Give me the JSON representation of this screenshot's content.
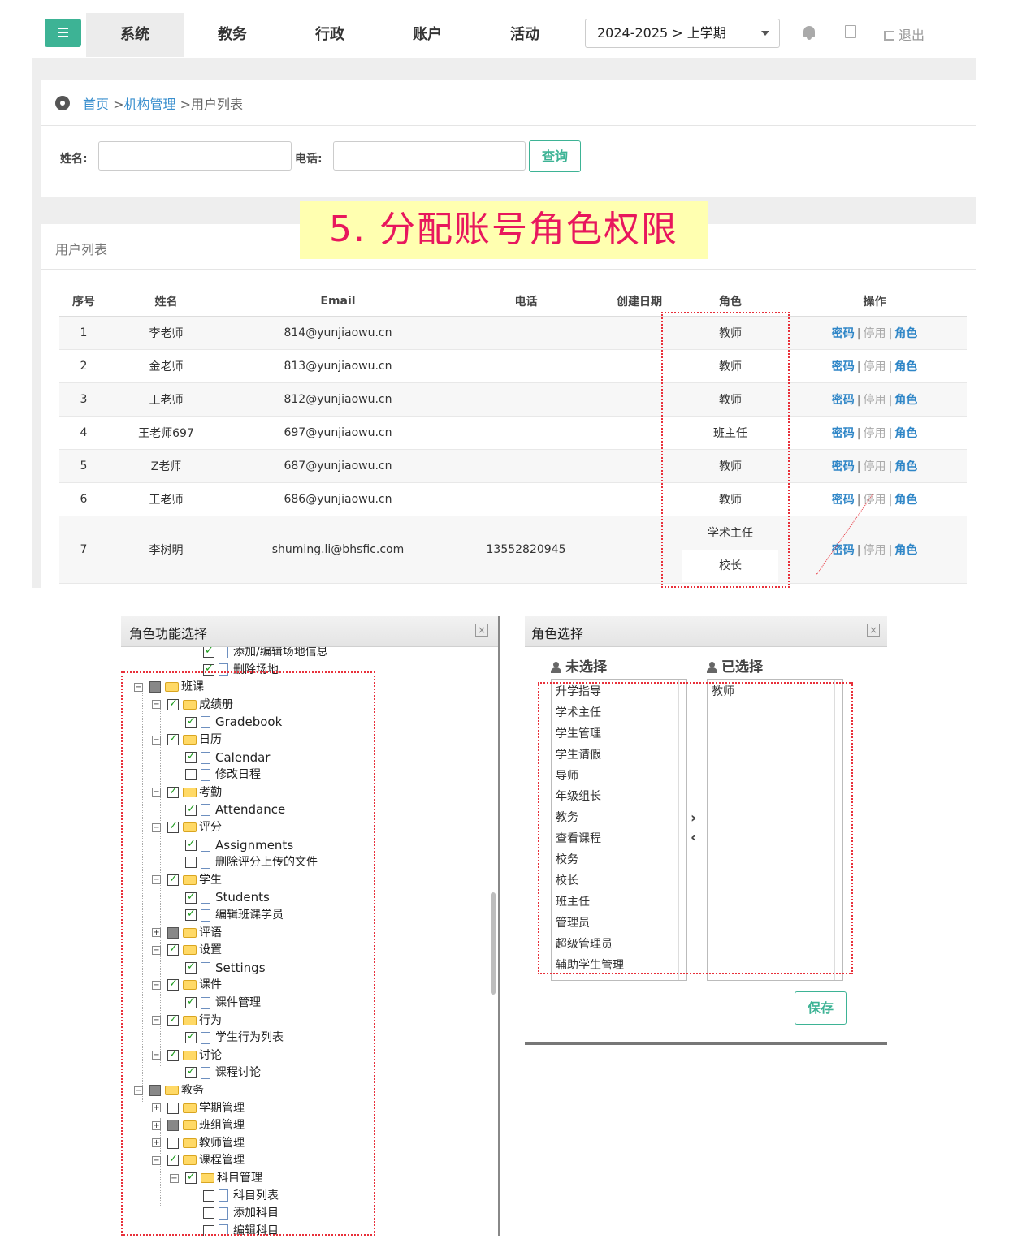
{
  "nav": {
    "items": [
      "系统",
      "教务",
      "行政",
      "账户",
      "活动"
    ],
    "term": "2024-2025 > 上学期",
    "logout": "退出"
  },
  "breadcrumb": {
    "home": "首页",
    "sep1": ">",
    "org": "机构管理",
    "sep2": ">",
    "current": "用户列表"
  },
  "search": {
    "name_label": "姓名:",
    "phone_label": "电话:",
    "query": "查询"
  },
  "annotation": "5. 分配账号角色权限",
  "list": {
    "title": "用户列表",
    "headers": [
      "序号",
      "姓名",
      "Email",
      "电话",
      "创建日期",
      "角色",
      "操作"
    ],
    "rows": [
      {
        "no": "1",
        "name": "李老师",
        "email": "814@yunjiaowu.cn",
        "phone": "",
        "date": "",
        "role": "教师"
      },
      {
        "no": "2",
        "name": "金老师",
        "email": "813@yunjiaowu.cn",
        "phone": "",
        "date": "",
        "role": "教师"
      },
      {
        "no": "3",
        "name": "王老师",
        "email": "812@yunjiaowu.cn",
        "phone": "",
        "date": "",
        "role": "教师"
      },
      {
        "no": "4",
        "name": "王老师697",
        "email": "697@yunjiaowu.cn",
        "phone": "",
        "date": "",
        "role": "班主任"
      },
      {
        "no": "5",
        "name": "Z老师",
        "email": "687@yunjiaowu.cn",
        "phone": "",
        "date": "",
        "role": "教师"
      },
      {
        "no": "6",
        "name": "王老师",
        "email": "686@yunjiaowu.cn",
        "phone": "",
        "date": "",
        "role": "教师"
      },
      {
        "no": "7",
        "name": "李树明",
        "email": "shuming.li@bhsfic.com",
        "phone": "13552820945",
        "date": "",
        "role": "学术主任",
        "role2": "校长"
      }
    ],
    "ops": {
      "password": "密码",
      "stop": "停用",
      "role": "角色",
      "bar": "|"
    }
  },
  "func_dialog": {
    "title": "角色功能选择",
    "close": "×",
    "nodes": [
      {
        "label": "添加/编辑场地信息",
        "level": 4,
        "state": "on",
        "icon": "doc"
      },
      {
        "label": "删除场地",
        "level": 4,
        "state": "on",
        "icon": "doc"
      },
      {
        "label": "班课",
        "level": 1,
        "state": "part",
        "icon": "folder",
        "toggle": "⊟"
      },
      {
        "label": "成绩册",
        "level": 2,
        "state": "on",
        "icon": "folder",
        "toggle": "⊟"
      },
      {
        "label": "Gradebook",
        "level": 3,
        "state": "on",
        "icon": "doc",
        "en": true
      },
      {
        "label": "日历",
        "level": 2,
        "state": "on",
        "icon": "folder",
        "toggle": "⊟"
      },
      {
        "label": "Calendar",
        "level": 3,
        "state": "on",
        "icon": "doc",
        "en": true
      },
      {
        "label": "修改日程",
        "level": 3,
        "state": "off",
        "icon": "doc"
      },
      {
        "label": "考勤",
        "level": 2,
        "state": "on",
        "icon": "folder",
        "toggle": "⊟"
      },
      {
        "label": "Attendance",
        "level": 3,
        "state": "on",
        "icon": "doc",
        "en": true
      },
      {
        "label": "评分",
        "level": 2,
        "state": "on",
        "icon": "folder",
        "toggle": "⊟"
      },
      {
        "label": "Assignments",
        "level": 3,
        "state": "on",
        "icon": "doc",
        "en": true
      },
      {
        "label": "删除评分上传的文件",
        "level": 3,
        "state": "off",
        "icon": "doc"
      },
      {
        "label": "学生",
        "level": 2,
        "state": "on",
        "icon": "folder",
        "toggle": "⊟"
      },
      {
        "label": "Students",
        "level": 3,
        "state": "on",
        "icon": "doc",
        "en": true
      },
      {
        "label": "编辑班课学员",
        "level": 3,
        "state": "on",
        "icon": "doc"
      },
      {
        "label": "评语",
        "level": 2,
        "state": "part",
        "icon": "folder",
        "toggle": "⊞"
      },
      {
        "label": "设置",
        "level": 2,
        "state": "on",
        "icon": "folder",
        "toggle": "⊟"
      },
      {
        "label": "Settings",
        "level": 3,
        "state": "on",
        "icon": "doc",
        "en": true
      },
      {
        "label": "课件",
        "level": 2,
        "state": "on",
        "icon": "folder",
        "toggle": "⊟"
      },
      {
        "label": "课件管理",
        "level": 3,
        "state": "on",
        "icon": "doc"
      },
      {
        "label": "行为",
        "level": 2,
        "state": "on",
        "icon": "folder",
        "toggle": "⊟"
      },
      {
        "label": "学生行为列表",
        "level": 3,
        "state": "on",
        "icon": "doc"
      },
      {
        "label": "讨论",
        "level": 2,
        "state": "on",
        "icon": "folder",
        "toggle": "⊟"
      },
      {
        "label": "课程讨论",
        "level": 3,
        "state": "on",
        "icon": "doc"
      },
      {
        "label": "教务",
        "level": 1,
        "state": "part",
        "icon": "folder",
        "toggle": "⊟"
      },
      {
        "label": "学期管理",
        "level": 2,
        "state": "off",
        "icon": "folder",
        "toggle": "⊞"
      },
      {
        "label": "班组管理",
        "level": 2,
        "state": "part",
        "icon": "folder",
        "toggle": "⊞"
      },
      {
        "label": "教师管理",
        "level": 2,
        "state": "off",
        "icon": "folder",
        "toggle": "⊞"
      },
      {
        "label": "课程管理",
        "level": 2,
        "state": "on",
        "icon": "folder",
        "toggle": "⊟"
      },
      {
        "label": "科目管理",
        "level": 3,
        "state": "on",
        "icon": "folder",
        "toggle": "⊟"
      },
      {
        "label": "科目列表",
        "level": 4,
        "state": "off",
        "icon": "doc"
      },
      {
        "label": "添加科目",
        "level": 4,
        "state": "off",
        "icon": "doc"
      },
      {
        "label": "编辑科目",
        "level": 4,
        "state": "off",
        "icon": "doc"
      }
    ]
  },
  "role_dialog": {
    "title": "角色选择",
    "close": "×",
    "unselected_label": "未选择",
    "selected_label": "已选择",
    "unselected": [
      "升学指导",
      "学术主任",
      "学生管理",
      "学生请假",
      "导师",
      "年级组长",
      "教务",
      "查看课程",
      "校务",
      "校长",
      "班主任",
      "管理员",
      "超级管理员",
      "辅助学生管理"
    ],
    "selected": [
      "教师"
    ],
    "move_right": "›",
    "move_left": "‹",
    "save": "保存"
  },
  "colors": {
    "accent": "#3db395",
    "link": "#2f86c7",
    "annot_text": "#e8175d",
    "annot_bg": "#ffffb0",
    "dotted": "#e8303a"
  }
}
